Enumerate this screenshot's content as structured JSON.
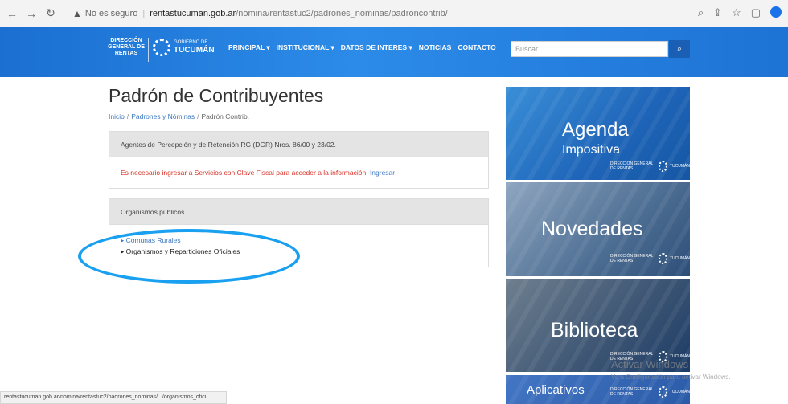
{
  "browser": {
    "insecure_label": "No es seguro",
    "host": "rentastucuman.gob.ar",
    "path": "/nomina/rentastuc2/padrones_nominas/padroncontrib/"
  },
  "header": {
    "logo_dgr": "DIRECCIÓN GENERAL DE RENTAS",
    "logo_gob_small": "GOBIERNO DE",
    "logo_gob_big": "TUCUMÁN",
    "menu": [
      "PRINCIPAL ▾",
      "INSTITUCIONAL ▾",
      "DATOS DE INTERES ▾",
      "NOTICIAS",
      "CONTACTO"
    ],
    "search_placeholder": "Buscar"
  },
  "main": {
    "title": "Padrón de Contribuyentes",
    "breadcrumb": [
      "Inicio",
      "Padrones y Nóminas",
      "Padrón Contrib."
    ],
    "panel1_header": "Agentes de Percepción y de Retención RG (DGR) Nros. 86/00 y 23/02.",
    "panel1_msg": "Es necesario ingresar a Servicios con Clave Fiscal para acceder a la información.",
    "panel1_link": "Ingresar",
    "panel2_header": "Organismos publicos.",
    "panel2_links": [
      "▸ Comunas Rurales",
      "▸ Organismos y Reparticiones Oficiales"
    ]
  },
  "sidebar": {
    "tile1_big": "Agenda",
    "tile1_small": "Impositiva",
    "tile2": "Novedades",
    "tile3": "Biblioteca",
    "tile4": "Aplicativos"
  },
  "watermark": {
    "line1": "Activar Windows",
    "line2": "Ve a Configuración para activar Windows."
  },
  "status_url": "rentastucuman.gob.ar/nomina/rentastuc2/padrones_nominas/.../organismos_ofici..."
}
